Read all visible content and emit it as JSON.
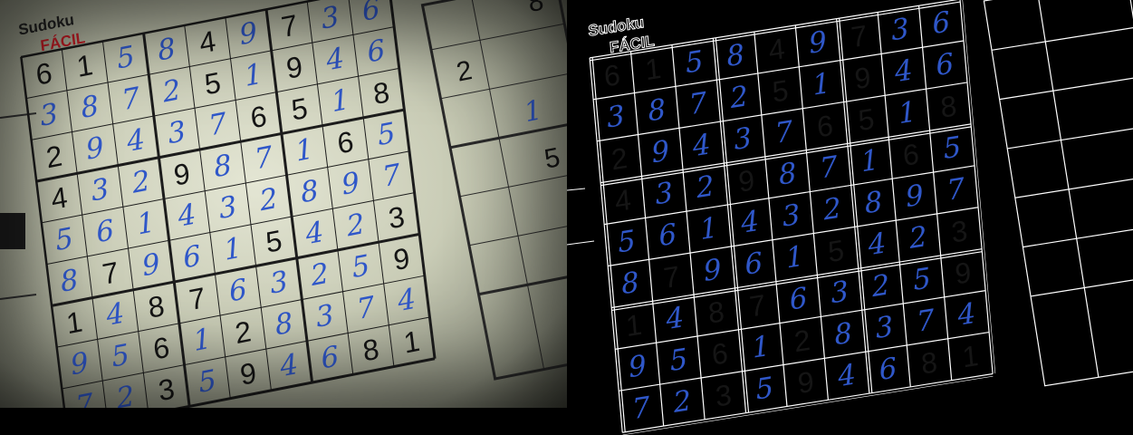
{
  "puzzle": {
    "title": "Sudoku",
    "level": "FÁCIL",
    "grid": [
      [
        {
          "v": "6",
          "p": 1
        },
        {
          "v": "1",
          "p": 1
        },
        {
          "v": "5",
          "p": 0
        },
        {
          "v": "8",
          "p": 0
        },
        {
          "v": "4",
          "p": 1
        },
        {
          "v": "9",
          "p": 0
        },
        {
          "v": "7",
          "p": 1
        },
        {
          "v": "3",
          "p": 0
        },
        {
          "v": "6",
          "p": 0
        }
      ],
      [
        {
          "v": "3",
          "p": 0
        },
        {
          "v": "8",
          "p": 0
        },
        {
          "v": "7",
          "p": 0
        },
        {
          "v": "2",
          "p": 0
        },
        {
          "v": "5",
          "p": 1
        },
        {
          "v": "1",
          "p": 0
        },
        {
          "v": "9",
          "p": 1
        },
        {
          "v": "4",
          "p": 0
        },
        {
          "v": "6",
          "p": 0
        }
      ],
      [
        {
          "v": "2",
          "p": 1
        },
        {
          "v": "9",
          "p": 0
        },
        {
          "v": "4",
          "p": 0
        },
        {
          "v": "3",
          "p": 0
        },
        {
          "v": "7",
          "p": 0
        },
        {
          "v": "6",
          "p": 1
        },
        {
          "v": "5",
          "p": 1
        },
        {
          "v": "1",
          "p": 0
        },
        {
          "v": "8",
          "p": 1
        }
      ],
      [
        {
          "v": "4",
          "p": 1
        },
        {
          "v": "3",
          "p": 0
        },
        {
          "v": "2",
          "p": 0
        },
        {
          "v": "9",
          "p": 1
        },
        {
          "v": "8",
          "p": 0
        },
        {
          "v": "7",
          "p": 0
        },
        {
          "v": "1",
          "p": 0
        },
        {
          "v": "6",
          "p": 1
        },
        {
          "v": "5",
          "p": 0
        }
      ],
      [
        {
          "v": "5",
          "p": 0
        },
        {
          "v": "6",
          "p": 0
        },
        {
          "v": "1",
          "p": 0
        },
        {
          "v": "4",
          "p": 0
        },
        {
          "v": "3",
          "p": 0
        },
        {
          "v": "2",
          "p": 0
        },
        {
          "v": "8",
          "p": 0
        },
        {
          "v": "9",
          "p": 0
        },
        {
          "v": "7",
          "p": 0
        }
      ],
      [
        {
          "v": "8",
          "p": 0
        },
        {
          "v": "7",
          "p": 1
        },
        {
          "v": "9",
          "p": 0
        },
        {
          "v": "6",
          "p": 0
        },
        {
          "v": "1",
          "p": 0
        },
        {
          "v": "5",
          "p": 1
        },
        {
          "v": "4",
          "p": 0
        },
        {
          "v": "2",
          "p": 0
        },
        {
          "v": "3",
          "p": 1
        }
      ],
      [
        {
          "v": "1",
          "p": 1
        },
        {
          "v": "4",
          "p": 0
        },
        {
          "v": "8",
          "p": 1
        },
        {
          "v": "7",
          "p": 1
        },
        {
          "v": "6",
          "p": 0
        },
        {
          "v": "3",
          "p": 0
        },
        {
          "v": "2",
          "p": 0
        },
        {
          "v": "5",
          "p": 0
        },
        {
          "v": "9",
          "p": 1
        }
      ],
      [
        {
          "v": "9",
          "p": 0
        },
        {
          "v": "5",
          "p": 0
        },
        {
          "v": "6",
          "p": 1
        },
        {
          "v": "1",
          "p": 0
        },
        {
          "v": "2",
          "p": 1
        },
        {
          "v": "8",
          "p": 0
        },
        {
          "v": "3",
          "p": 0
        },
        {
          "v": "7",
          "p": 0
        },
        {
          "v": "4",
          "p": 0
        }
      ],
      [
        {
          "v": "7",
          "p": 0
        },
        {
          "v": "2",
          "p": 0
        },
        {
          "v": "3",
          "p": 1
        },
        {
          "v": "5",
          "p": 0
        },
        {
          "v": "9",
          "p": 1
        },
        {
          "v": "4",
          "p": 0
        },
        {
          "v": "6",
          "p": 0
        },
        {
          "v": "8",
          "p": 1
        },
        {
          "v": "1",
          "p": 1
        }
      ]
    ]
  },
  "side_grid": {
    "values": [
      "8",
      "2",
      "1",
      "5"
    ]
  },
  "colors": {
    "paper": "#dfe1cf",
    "ink_printed": "#151515",
    "ink_handwritten": "#2f57c9",
    "level_red": "#c21d25",
    "edge_line": "#ffffff",
    "edge_background": "#000000"
  }
}
